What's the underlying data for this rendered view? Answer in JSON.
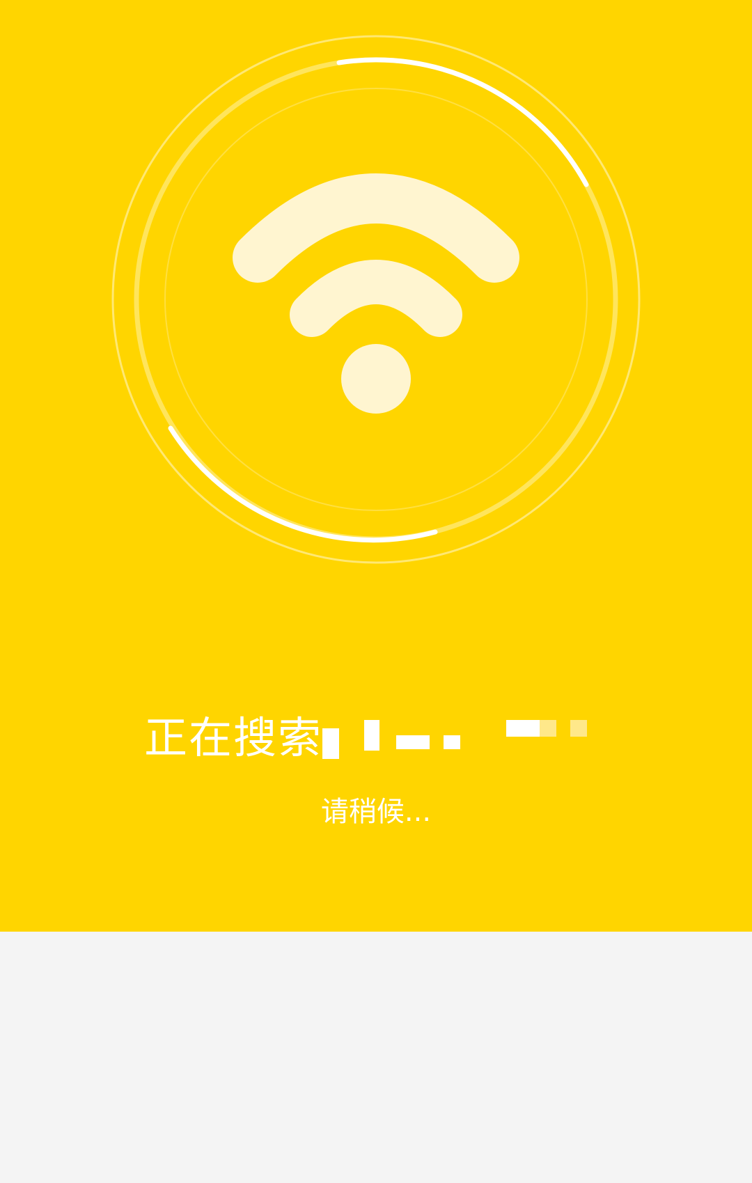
{
  "screen": {
    "title": "正在搜索",
    "subtitle": "请稍候..."
  },
  "icons": {
    "center": "wifi-icon",
    "rings": "scanning-ring-icon"
  },
  "colors": {
    "primary": "#FFD500",
    "icon_fill": "#FFF5D0",
    "text": "#FFFFFF",
    "background": "#F4F4F4"
  }
}
